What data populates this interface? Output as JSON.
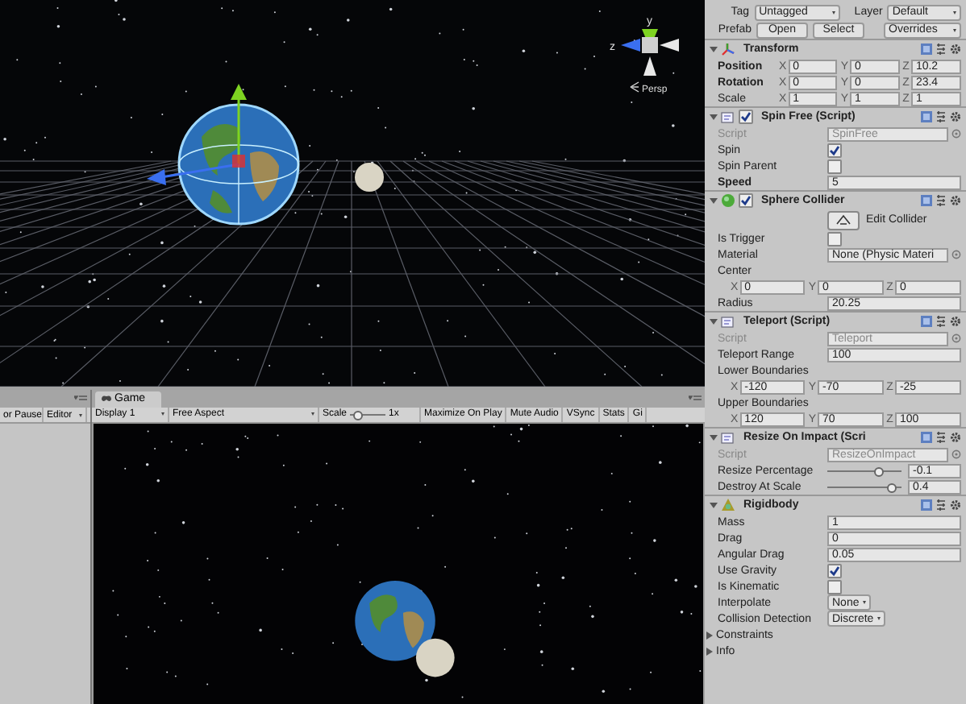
{
  "scene_view": {
    "axis_labels": [
      "y",
      "z"
    ],
    "projection": "Persp"
  },
  "left_panel": {
    "toolbar": [
      "or Pause",
      "Editor"
    ]
  },
  "game_view": {
    "tab": "Game",
    "toolbar": [
      {
        "kind": "dropdown",
        "label": "Display 1"
      },
      {
        "kind": "dropdown",
        "label": "Free Aspect"
      },
      {
        "kind": "slider",
        "label": "Scale",
        "level": 0.1,
        "reading": "1x"
      },
      {
        "kind": "toggle",
        "label": "Maximize On Play"
      },
      {
        "kind": "toggle",
        "label": "Mute Audio"
      },
      {
        "kind": "toggle",
        "label": "VSync"
      },
      {
        "kind": "toggle",
        "label": "Stats"
      },
      {
        "kind": "toggle",
        "label": "Gi"
      }
    ]
  },
  "inspector": {
    "tag_label": "Tag",
    "tag": "Untagged",
    "layer_label": "Layer",
    "layer": "Default",
    "prefab_label": "Prefab",
    "prefab_buttons": [
      "Open",
      "Select"
    ],
    "overrides": "Overrides",
    "components": [
      {
        "kind": "transform",
        "title": "Transform",
        "rows": [
          {
            "kind": "xyz",
            "label": "Position",
            "bold": true,
            "axes": [
              {
                "axis": "X",
                "value": "0"
              },
              {
                "axis": "Y",
                "value": "0"
              },
              {
                "axis": "Z",
                "value": "10.2"
              }
            ]
          },
          {
            "kind": "xyz",
            "label": "Rotation",
            "bold": true,
            "axes": [
              {
                "axis": "X",
                "value": "0"
              },
              {
                "axis": "Y",
                "value": "0"
              },
              {
                "axis": "Z",
                "value": "23.4"
              }
            ]
          },
          {
            "kind": "xyz",
            "label": "Scale",
            "axes": [
              {
                "axis": "X",
                "value": "1"
              },
              {
                "axis": "Y",
                "value": "1"
              },
              {
                "axis": "Z",
                "value": "1"
              }
            ]
          }
        ]
      },
      {
        "kind": "script",
        "title": "Spin Free (Script)",
        "enabled": true,
        "rows": [
          {
            "kind": "object",
            "label": "Script",
            "value": "SpinFree",
            "disabled": true
          },
          {
            "kind": "toggle",
            "label": "Spin",
            "checked": true
          },
          {
            "kind": "toggle",
            "label": "Spin Parent",
            "checked": false
          },
          {
            "kind": "text",
            "label": "Speed",
            "bold": true,
            "value": "5"
          }
        ]
      },
      {
        "kind": "collider",
        "title": "Sphere Collider",
        "enabled": true,
        "rows": [
          {
            "kind": "button",
            "label": "Edit Collider"
          },
          {
            "kind": "toggle",
            "label": "Is Trigger",
            "checked": false
          },
          {
            "kind": "object",
            "label": "Material",
            "value": "None (Physic Materi",
            "disabled": false
          },
          {
            "kind": "heading",
            "label": "Center"
          },
          {
            "kind": "xyz",
            "axes": [
              {
                "axis": "X",
                "value": "0"
              },
              {
                "axis": "Y",
                "value": "0"
              },
              {
                "axis": "Z",
                "value": "0"
              }
            ]
          },
          {
            "kind": "text",
            "label": "Radius",
            "value": "20.25"
          }
        ]
      },
      {
        "kind": "script",
        "title": "Teleport (Script)",
        "rows": [
          {
            "kind": "object",
            "label": "Script",
            "value": "Teleport",
            "disabled": true
          },
          {
            "kind": "text",
            "label": "Teleport Range",
            "value": "100"
          },
          {
            "kind": "heading",
            "label": "Lower Boundaries"
          },
          {
            "kind": "xyz",
            "axes": [
              {
                "axis": "X",
                "value": "-120"
              },
              {
                "axis": "Y",
                "value": "-70"
              },
              {
                "axis": "Z",
                "value": "-25"
              }
            ]
          },
          {
            "kind": "heading",
            "label": "Upper Boundaries"
          },
          {
            "kind": "xyz",
            "axes": [
              {
                "axis": "X",
                "value": "120"
              },
              {
                "axis": "Y",
                "value": "70"
              },
              {
                "axis": "Z",
                "value": "100"
              }
            ]
          }
        ]
      },
      {
        "kind": "script",
        "title": "Resize On Impact (Scri",
        "rows": [
          {
            "kind": "object",
            "label": "Script",
            "value": "ResizeOnImpact",
            "disabled": true
          },
          {
            "kind": "slider",
            "label": "Resize Percentage",
            "level": 0.7,
            "value": "-0.1"
          },
          {
            "kind": "slider",
            "label": "Destroy At Scale",
            "level": 0.88,
            "value": "0.4"
          }
        ]
      },
      {
        "kind": "rigidbody",
        "title": "Rigidbody",
        "rows": [
          {
            "kind": "text",
            "label": "Mass",
            "value": "1"
          },
          {
            "kind": "text",
            "label": "Drag",
            "value": "0"
          },
          {
            "kind": "text",
            "label": "Angular Drag",
            "value": "0.05"
          },
          {
            "kind": "toggle",
            "label": "Use Gravity",
            "checked": true
          },
          {
            "kind": "toggle",
            "label": "Is Kinematic",
            "checked": false
          },
          {
            "kind": "dropdown",
            "label": "Interpolate",
            "value": "None"
          },
          {
            "kind": "dropdown",
            "label": "Collision Detection",
            "value": "Discrete"
          },
          {
            "kind": "foldout",
            "label": "Constraints"
          },
          {
            "kind": "foldout",
            "label": "Info"
          }
        ]
      }
    ]
  }
}
